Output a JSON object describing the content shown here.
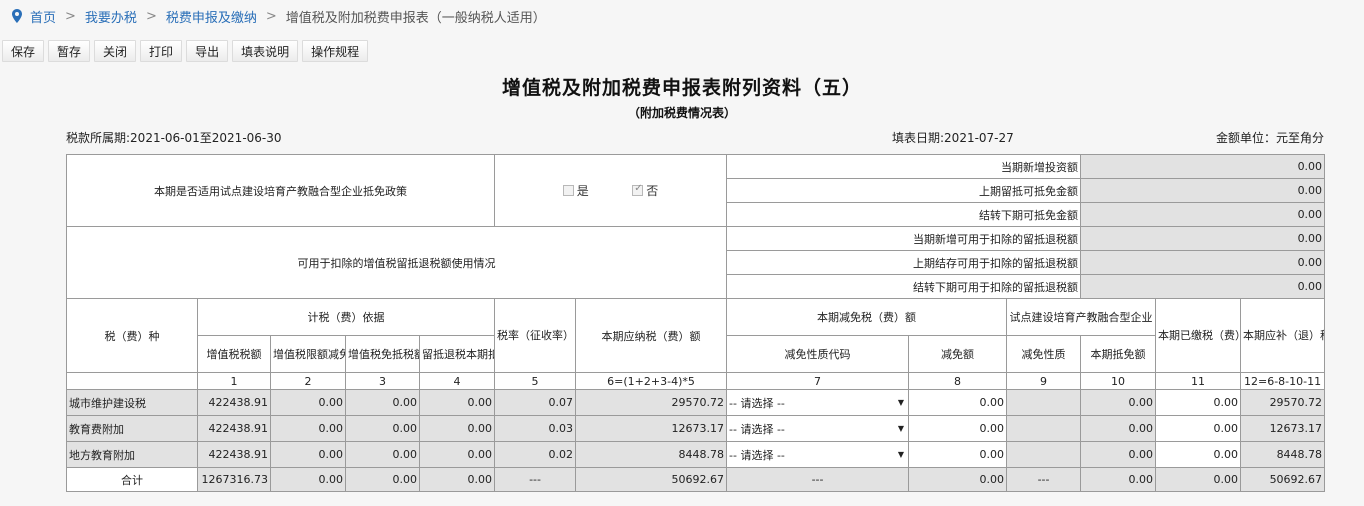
{
  "breadcrumb": {
    "items": [
      "首页",
      "我要办税",
      "税费申报及缴纳"
    ],
    "separator": ">",
    "current": "增值税及附加税费申报表（一般纳税人适用）"
  },
  "toolbar": {
    "save": "保存",
    "draft": "暂存",
    "close": "关闭",
    "print": "打印",
    "export": "导出",
    "guide": "填表说明",
    "rules": "操作规程"
  },
  "title": "增值税及附加税费申报表附列资料（五）",
  "subtitle": "（附加税费情况表）",
  "meta": {
    "period": "税款所属期:2021-06-01至2021-06-30",
    "fill_date": "填表日期:2021-07-27",
    "unit": "金额单位：元至角分"
  },
  "policy": {
    "question": "本期是否适用试点建设培育产教融合型企业抵免政策",
    "yes": "是",
    "yes_checked": false,
    "no": "否",
    "no_checked": true,
    "rows": [
      {
        "label": "当期新增投资额",
        "value": "0.00"
      },
      {
        "label": "上期留抵可抵免金额",
        "value": "0.00"
      },
      {
        "label": "结转下期可抵免金额",
        "value": "0.00"
      }
    ]
  },
  "refund": {
    "label": "可用于扣除的增值税留抵退税额使用情况",
    "rows": [
      {
        "label": "当期新增可用于扣除的留抵退税额",
        "value": "0.00"
      },
      {
        "label": "上期结存可用于扣除的留抵退税额",
        "value": "0.00"
      },
      {
        "label": "结转下期可用于扣除的留抵退税额",
        "value": "0.00"
      }
    ]
  },
  "headers": {
    "tax_type": "税（费）种",
    "basis": "计税（费）依据",
    "vat_amount": "增值税税额",
    "limit_exempt": "增值税限额减免金额",
    "exempt_offset": "增值税免抵税额",
    "refund_deduct": "留抵退税本期扣除额",
    "rate": "税率（征收率）",
    "payable": "本期应纳税（费）额",
    "reduction": "本期减免税（费）额",
    "reduction_code": "减免性质代码",
    "reduction_amount": "减免额",
    "pilot": "试点建设培育产教融合型企业",
    "pilot_code": "减免性质",
    "pilot_offset": "本期抵免额",
    "paid": "本期已缴税（费）额",
    "due": "本期应补（退）税（费）额"
  },
  "col_numbers": [
    "1",
    "2",
    "3",
    "4",
    "5",
    "6=(1+2+3-4)*5",
    "7",
    "8",
    "9",
    "10",
    "11",
    "12=6-8-10-11"
  ],
  "rows": [
    {
      "name": "城市维护建设税",
      "c1": "422438.91",
      "c2": "0.00",
      "c3": "0.00",
      "c4": "0.00",
      "c5": "0.07",
      "c6": "29570.72",
      "c7": "-- 请选择 --",
      "c8": "0.00",
      "c10": "0.00",
      "c11": "0.00",
      "c12": "29570.72"
    },
    {
      "name": "教育费附加",
      "c1": "422438.91",
      "c2": "0.00",
      "c3": "0.00",
      "c4": "0.00",
      "c5": "0.03",
      "c6": "12673.17",
      "c7": "-- 请选择 --",
      "c8": "0.00",
      "c10": "0.00",
      "c11": "0.00",
      "c12": "12673.17"
    },
    {
      "name": "地方教育附加",
      "c1": "422438.91",
      "c2": "0.00",
      "c3": "0.00",
      "c4": "0.00",
      "c5": "0.02",
      "c6": "8448.78",
      "c7": "-- 请选择 --",
      "c8": "0.00",
      "c10": "0.00",
      "c11": "0.00",
      "c12": "8448.78"
    }
  ],
  "total": {
    "name": "合计",
    "c1": "1267316.73",
    "c2": "0.00",
    "c3": "0.00",
    "c4": "0.00",
    "c5": "---",
    "c6": "50692.67",
    "c7": "---",
    "c8": "0.00",
    "c9": "---",
    "c10": "0.00",
    "c11": "0.00",
    "c12": "50692.67"
  },
  "colors": {
    "link": "#2a6fb8",
    "gray_cell": "#e2e2e2",
    "border": "#9a9a9a"
  }
}
